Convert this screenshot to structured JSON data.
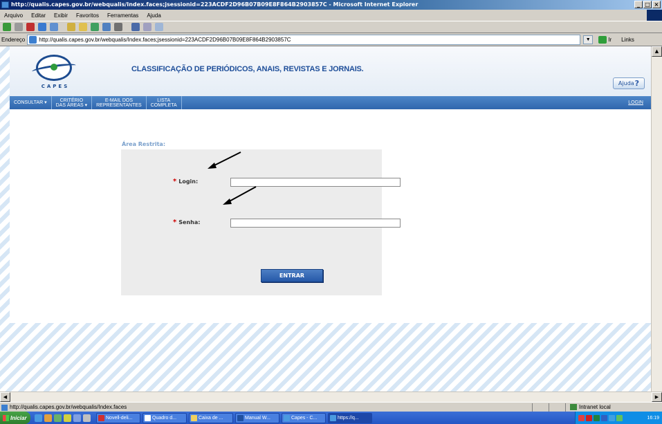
{
  "window": {
    "title": "http://qualis.capes.gov.br/webqualis/Index.faces;jsessionid=223ACDF2D96B07B09E8F864B2903857C - Microsoft Internet Explorer"
  },
  "menu": [
    "Arquivo",
    "Editar",
    "Exibir",
    "Favoritos",
    "Ferramentas",
    "Ajuda"
  ],
  "address": {
    "label": "Endereço",
    "url": "http://qualis.capes.gov.br/webqualis/Index.faces;jsessionid=223ACDF2D96B07B09E8F864B2903857C",
    "go_label": "Ir",
    "links_label": "Links"
  },
  "site": {
    "logo_text": "CAPES",
    "title": "CLASSIFICAÇÃO DE PERIÓDICOS, ANAIS, REVISTAS E JORNAIS.",
    "help_label": "Ajuda"
  },
  "nav": {
    "consultar": "CONSULTAR ▾",
    "criterio_line1": "CRITÉRIO",
    "criterio_line2": "DAS ÁREAS ▾",
    "email_line1": "E-MAIL DOS",
    "email_line2": "REPRESENTANTES",
    "lista_line1": "LISTA",
    "lista_line2": "COMPLETA",
    "login": "LOGIN"
  },
  "form": {
    "area_title": "Área Restrita:",
    "required_mark": "*",
    "login_label": "Login:",
    "login_value": "",
    "password_label": "Senha:",
    "password_value": "",
    "submit_label": "ENTRAR"
  },
  "status": {
    "text": "http://qualis.capes.gov.br/webqualis/Index.faces",
    "zone": "Intranet local"
  },
  "taskbar": {
    "start": "Iniciar",
    "tasks": [
      "Novell-deli...",
      "Quadro d...",
      "Caixa de ...",
      "Manual W...",
      "Capes - C...",
      "https://q..."
    ],
    "clock": "16:19"
  }
}
